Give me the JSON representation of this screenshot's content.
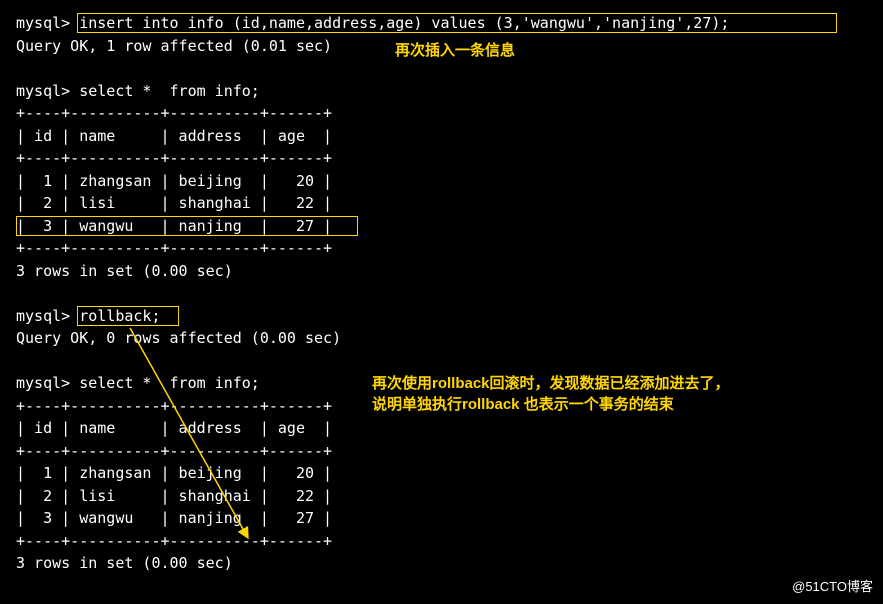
{
  "prompt": "mysql> ",
  "insert_cmd": "insert into info (id,name,address,age) values (3,'wangwu','nanjing',27);",
  "insert_result": "Query OK, 1 row affected (0.01 sec)",
  "annotation1": "再次插入一条信息",
  "select_cmd": "select *  from info;",
  "table_border": "+----+----------+----------+------+",
  "table_header": "| id | name     | address  | age  |",
  "table_rows": [
    "|  1 | zhangsan | beijing  |   20 |",
    "|  2 | lisi     | shanghai |   22 |",
    "|  3 | wangwu   | nanjing  |   27 |"
  ],
  "rows_in_set": "3 rows in set (0.00 sec)",
  "rollback_cmd": "rollback;",
  "rollback_result": "Query OK, 0 rows affected (0.00 sec)",
  "annotation2_line1": "再次使用rollback回滚时，发现数据已经添加进去了，",
  "annotation2_line2": "说明单独执行rollback 也表示一个事务的结束",
  "watermark": "@51CTO博客",
  "blank": ""
}
